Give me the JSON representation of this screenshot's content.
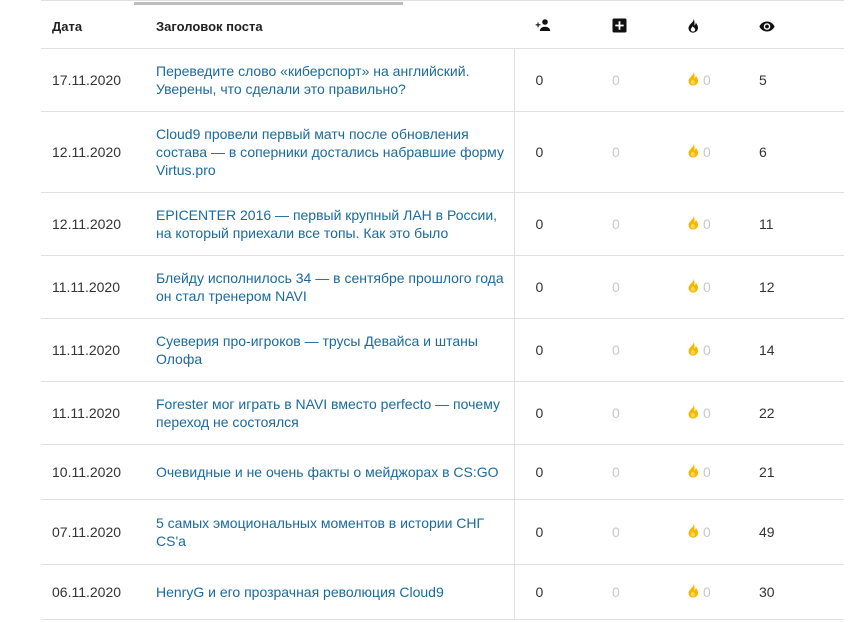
{
  "colors": {
    "link": "#1a6a9e",
    "flame": "#f5b800",
    "muted": "#c8c8c8",
    "border": "#e0e0e0"
  },
  "header": {
    "date_label": "Дата",
    "title_label": "Заголовок поста",
    "subscribers_icon": "add-person-icon",
    "plus_icon": "plus-box-icon",
    "fire_icon": "flame-icon",
    "views_icon": "eye-icon"
  },
  "rows": [
    {
      "date": "17.11.2020",
      "title": "Переведите слово «киберспорт» на английский. Уверены, что сделали это правильно?",
      "subs": "0",
      "plus": "0",
      "fire": "0",
      "views": "5"
    },
    {
      "date": "12.11.2020",
      "title": "Cloud9 провели первый матч после обновления состава — в соперники достались набравшие форму Virtus.pro",
      "subs": "0",
      "plus": "0",
      "fire": "0",
      "views": "6"
    },
    {
      "date": "12.11.2020",
      "title": "EPICENTER 2016 — первый крупный ЛАН в России, на который приехали все топы. Как это было",
      "subs": "0",
      "plus": "0",
      "fire": "0",
      "views": "11"
    },
    {
      "date": "11.11.2020",
      "title": "Блейду исполнилось 34 — в сентябре прошлого года он стал тренером NAVI",
      "subs": "0",
      "plus": "0",
      "fire": "0",
      "views": "12"
    },
    {
      "date": "11.11.2020",
      "title": "Суеверия про-игроков — трусы Девайса и штаны Олофа",
      "subs": "0",
      "plus": "0",
      "fire": "0",
      "views": "14"
    },
    {
      "date": "11.11.2020",
      "title": "Forester мог играть в NAVI вместо perfecto — почему переход не состоялся",
      "subs": "0",
      "plus": "0",
      "fire": "0",
      "views": "22"
    },
    {
      "date": "10.11.2020",
      "title": "Очевидные и не очень факты о мейджорах в CS:GO",
      "subs": "0",
      "plus": "0",
      "fire": "0",
      "views": "21"
    },
    {
      "date": "07.11.2020",
      "title": "5 самых эмоциональных моментов в истории СНГ CS'a",
      "subs": "0",
      "plus": "0",
      "fire": "0",
      "views": "49"
    },
    {
      "date": "06.11.2020",
      "title": "HenryG и его прозрачная революция Cloud9",
      "subs": "0",
      "plus": "0",
      "fire": "0",
      "views": "30"
    }
  ]
}
